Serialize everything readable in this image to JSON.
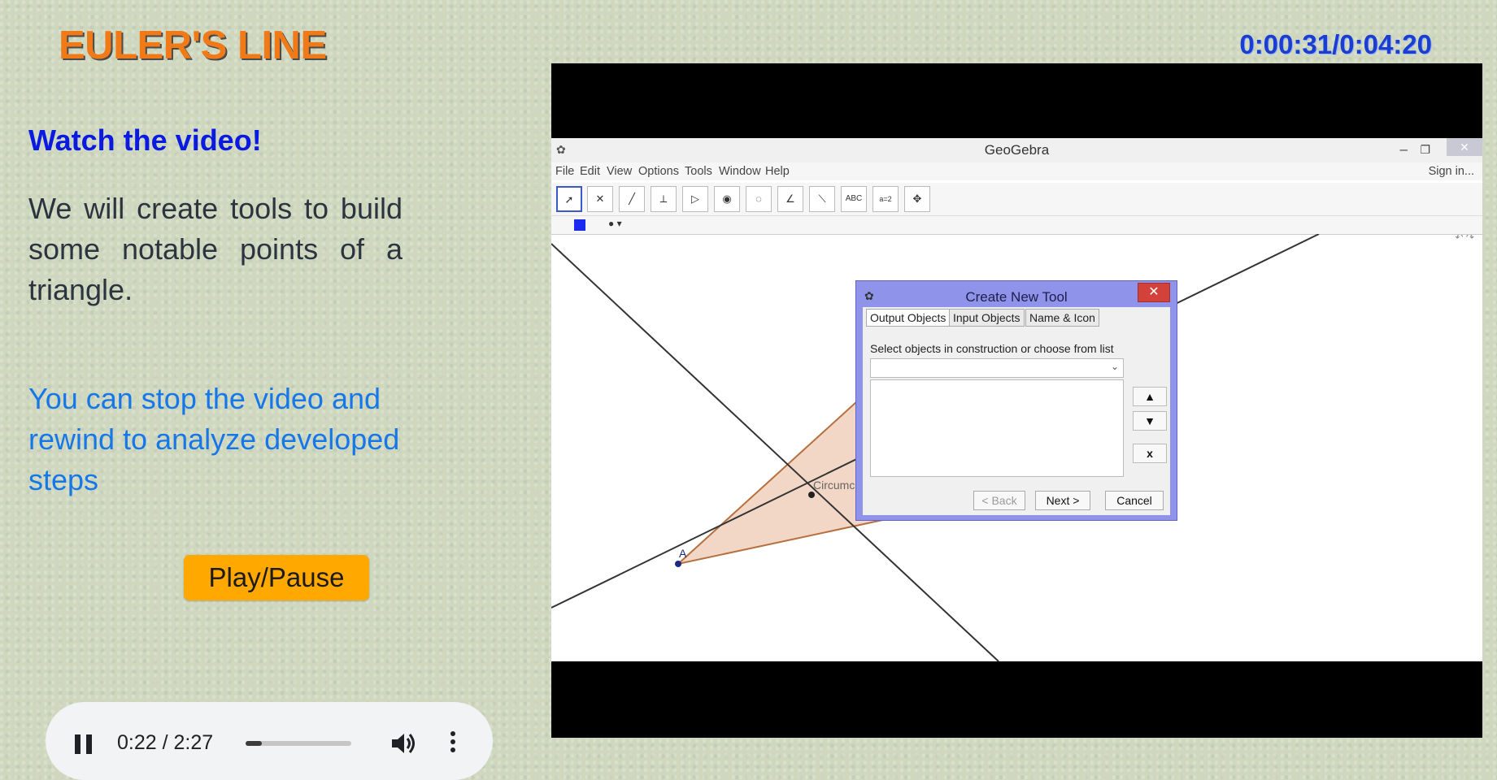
{
  "title": "EULER'S LINE",
  "timer": "0:00:31/0:04:20",
  "watch_heading": "Watch the video!",
  "description": "We will create tools to build some notable points of a triangle.",
  "hint": "You can stop the video and rewind to analyze developed steps",
  "play_pause_label": "Play/Pause",
  "audio": {
    "time": "0:22 / 2:27",
    "progress": 0.15
  },
  "geogebra": {
    "window_title": "GeoGebra",
    "menu": [
      "File",
      "Edit",
      "View",
      "Options",
      "Tools",
      "Window",
      "Help"
    ],
    "sign_in": "Sign in...",
    "point_label_A": "A",
    "circum_label": "Circumc",
    "tool_text_abc": "ABC",
    "tool_text_slider": "a=2",
    "colors": {
      "triangle_fill": "#f3d7c6",
      "triangle_edge": "#b5703f",
      "point": "#1a2a80"
    }
  },
  "dialog": {
    "title": "Create New Tool",
    "tabs": [
      "Output Objects",
      "Input Objects",
      "Name & Icon"
    ],
    "instruction": "Select objects in construction or choose from list",
    "up": "▲",
    "down": "▼",
    "remove": "x",
    "back": "< Back",
    "next": "Next >",
    "cancel": "Cancel"
  }
}
